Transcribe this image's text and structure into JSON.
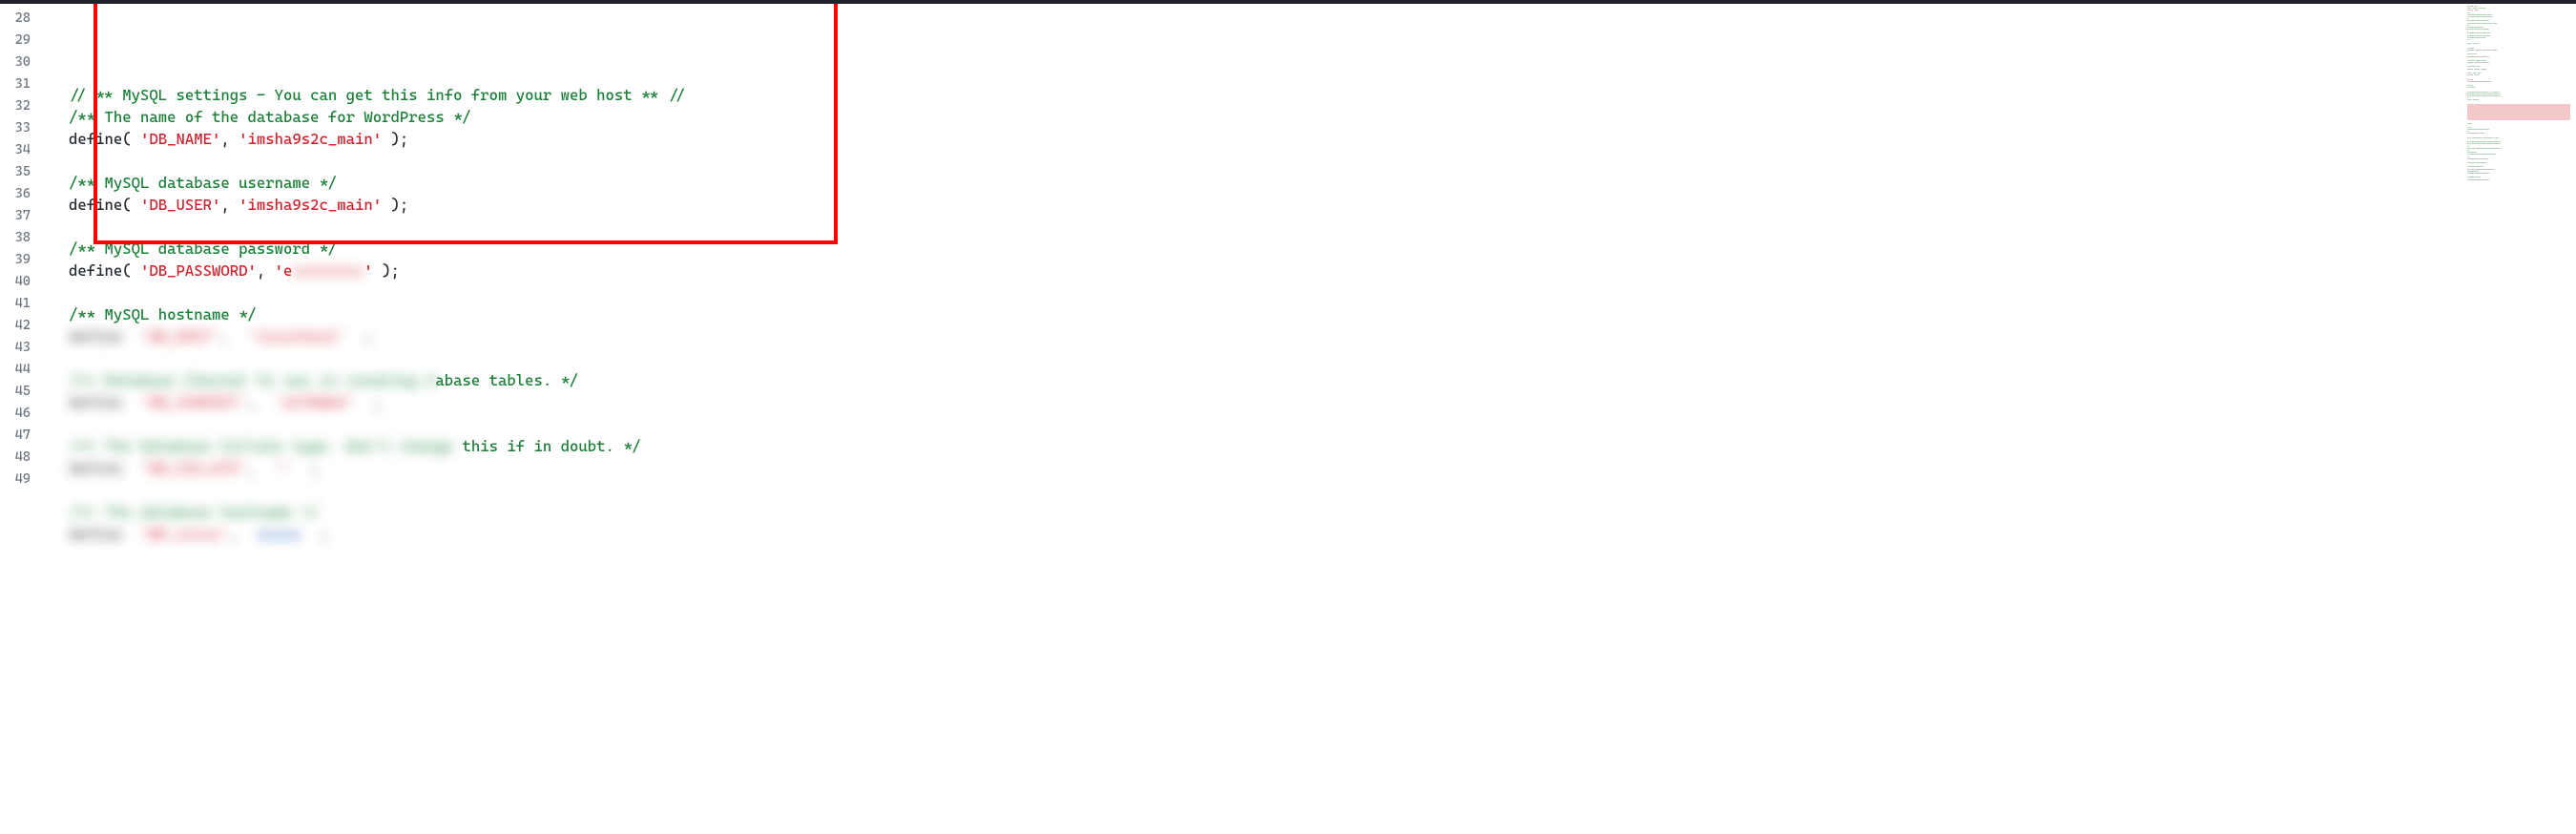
{
  "editor": {
    "startLine": 28,
    "lines": [
      {
        "num": 28,
        "segments": []
      },
      {
        "num": 29,
        "segments": [
          {
            "cls": "tok-comment",
            "text": "// ** MySQL settings - You can get this info from your web host ** //"
          }
        ]
      },
      {
        "num": 30,
        "segments": [
          {
            "cls": "tok-comment",
            "text": "/** The name of the database for WordPress */"
          }
        ]
      },
      {
        "num": 31,
        "segments": [
          {
            "cls": "tok-func",
            "text": "define"
          },
          {
            "cls": "tok-punct",
            "text": "( "
          },
          {
            "cls": "tok-string",
            "text": "'DB_NAME'"
          },
          {
            "cls": "tok-punct",
            "text": ", "
          },
          {
            "cls": "tok-string",
            "text": "'imsha9s2c_main'"
          },
          {
            "cls": "tok-punct",
            "text": " );"
          }
        ]
      },
      {
        "num": 32,
        "segments": []
      },
      {
        "num": 33,
        "segments": [
          {
            "cls": "tok-comment",
            "text": "/** MySQL database username */"
          }
        ]
      },
      {
        "num": 34,
        "segments": [
          {
            "cls": "tok-func",
            "text": "define"
          },
          {
            "cls": "tok-punct",
            "text": "( "
          },
          {
            "cls": "tok-string",
            "text": "'DB_USER'"
          },
          {
            "cls": "tok-punct",
            "text": ", "
          },
          {
            "cls": "tok-string",
            "text": "'imsha9s2c_main'"
          },
          {
            "cls": "tok-punct",
            "text": " );"
          }
        ]
      },
      {
        "num": 35,
        "segments": []
      },
      {
        "num": 36,
        "segments": [
          {
            "cls": "tok-comment",
            "text": "/** MySQL database password */"
          }
        ]
      },
      {
        "num": 37,
        "segments": [
          {
            "cls": "tok-func",
            "text": "define"
          },
          {
            "cls": "tok-punct",
            "text": "( "
          },
          {
            "cls": "tok-string",
            "text": "'DB_PASSWORD'"
          },
          {
            "cls": "tok-punct",
            "text": ", "
          },
          {
            "cls": "tok-string",
            "text": "'e"
          },
          {
            "cls": "tok-string blur-overlay",
            "text": "xxxxxxxx"
          },
          {
            "cls": "tok-string",
            "text": "'"
          },
          {
            "cls": "tok-punct",
            "text": " );"
          }
        ]
      },
      {
        "num": 38,
        "segments": []
      },
      {
        "num": 39,
        "segments": [
          {
            "cls": "tok-comment",
            "text": "/** MySQL hostname */"
          }
        ]
      },
      {
        "num": 40,
        "segments": [
          {
            "cls": "blur-overlay blur-dark",
            "text": "define  "
          },
          {
            "cls": "blur-overlay blur-red",
            "text": "'DB_HOST'"
          },
          {
            "cls": "blur-overlay blur-dark",
            "text": ",  "
          },
          {
            "cls": "blur-overlay blur-red",
            "text": "'localhost'"
          },
          {
            "cls": "blur-overlay blur-dark",
            "text": "  ;"
          }
        ]
      },
      {
        "num": 41,
        "segments": []
      },
      {
        "num": 42,
        "segments": [
          {
            "cls": "blur-overlay blur-green",
            "text": "/** Database Charset to use in creating d"
          },
          {
            "cls": "tok-comment",
            "text": "abase tables. */"
          }
        ]
      },
      {
        "num": 43,
        "segments": [
          {
            "cls": "blur-overlay blur-dark",
            "text": "define  "
          },
          {
            "cls": "blur-overlay blur-red",
            "text": "'DB_CHARSET'"
          },
          {
            "cls": "blur-overlay blur-dark",
            "text": ",  "
          },
          {
            "cls": "blur-overlay blur-red",
            "text": "'utf8mb4'"
          },
          {
            "cls": "blur-overlay blur-dark",
            "text": "  ;"
          }
        ]
      },
      {
        "num": 44,
        "segments": []
      },
      {
        "num": 45,
        "segments": [
          {
            "cls": "blur-overlay blur-green",
            "text": "/** The Database Collate type. Don't change"
          },
          {
            "cls": "tok-comment",
            "text": " this if in doubt. */"
          }
        ]
      },
      {
        "num": 46,
        "segments": [
          {
            "cls": "blur-overlay blur-dark",
            "text": "define  "
          },
          {
            "cls": "blur-overlay blur-red",
            "text": "'DB_COLLATE'"
          },
          {
            "cls": "blur-overlay blur-dark",
            "text": ",  "
          },
          {
            "cls": "blur-overlay blur-red",
            "text": "''"
          },
          {
            "cls": "blur-overlay blur-dark",
            "text": "  ;"
          }
        ]
      },
      {
        "num": 47,
        "segments": []
      },
      {
        "num": 48,
        "segments": [
          {
            "cls": "blur-overlay blur-green",
            "text": "/** The database hostname */"
          }
        ]
      },
      {
        "num": 49,
        "segments": [
          {
            "cls": "blur-overlay blur-dark",
            "text": "define  "
          },
          {
            "cls": "blur-overlay blur-red",
            "text": "'WP_xxxxx'"
          },
          {
            "cls": "blur-overlay blur-dark",
            "text": ",  "
          },
          {
            "cls": "blur-overlay blur-blue",
            "text": "xxxxx"
          },
          {
            "cls": "blur-overlay blur-dark",
            "text": "  ;"
          }
        ]
      }
    ]
  },
  "minimap": {
    "lines": [
      {
        "c": "mm-dark",
        "t": "xxxxx xxx"
      },
      {
        "c": "mm-green",
        "t": "xxxx xxxx xxxxxx"
      },
      {
        "c": "mm-red",
        "t": "xxxxx xxxx"
      },
      {
        "c": "mm-green",
        "t": "xx"
      },
      {
        "c": "mm-green",
        "t": "xxxxxxxxxxxxxxxxxxxxxx"
      },
      {
        "c": "mm-green",
        "t": "xxxxxxxxxxxxxxxxxxxxxx"
      },
      {
        "c": "mm-green",
        "t": "x"
      },
      {
        "c": "mm-green",
        "t": "xxxxxxxxxxxxxxxxxxx"
      },
      {
        "c": "mm-green",
        "t": "xxxxxxxxxxxxxxxxxxxxxxxxxx"
      },
      {
        "c": "mm-green",
        "t": "xx"
      },
      {
        "c": "mm-green",
        "t": "xxxxxxxxxxxxxx"
      },
      {
        "c": "mm-green",
        "t": "xxxxx xxxxxxxxxxxxx"
      },
      {
        "c": "mm-green",
        "t": "x"
      },
      {
        "c": "mm-green",
        "t": "xxxxxxxxxxxxxxxxxxxx"
      },
      {
        "c": "mm-green",
        "t": "xxxxxxxxxxxxxxxxxxxx"
      },
      {
        "c": "mm-green",
        "t": "xxxxxxxxxxxxxxxx"
      },
      {
        "c": "mm-green",
        "t": "xx"
      },
      {
        "c": "",
        "t": ""
      },
      {
        "c": "mm-green",
        "t": "xxxx xxxxx"
      },
      {
        "c": "",
        "t": ""
      },
      {
        "c": "mm-green",
        "t": "xxxxxx"
      },
      {
        "c": "mm-dark",
        "t": "xxxxxx xxxxxx xxxxxx xxxxx"
      },
      {
        "c": "",
        "t": ""
      },
      {
        "c": "mm-green",
        "t": "xxxxxxxx"
      },
      {
        "c": "mm-dark",
        "t": "xxxxxxxxxxxxxxxxxxx"
      },
      {
        "c": "",
        "t": ""
      },
      {
        "c": "mm-green",
        "t": "xxxxxxxxxxxxxxxxx"
      },
      {
        "c": "mm-dark",
        "t": "xxxxx xxxxxx xxxxxx"
      },
      {
        "c": "",
        "t": ""
      },
      {
        "c": "mm-green",
        "t": "xxxxxxxxxxx"
      },
      {
        "c": "mm-dark",
        "t": "xxxxx xxxxx xxxxx"
      },
      {
        "c": "",
        "t": ""
      },
      {
        "c": "mm-green",
        "t": "xxxx xxx xxx"
      },
      {
        "c": "mm-dark",
        "t": "xxxxx xxxx"
      },
      {
        "c": "",
        "t": ""
      },
      {
        "c": "mm-red",
        "t": "xxxxx"
      },
      {
        "c": "mm-dark",
        "t": "xxxxxxxxxxxxxxxxxxxxx"
      },
      {
        "c": "",
        "t": ""
      },
      {
        "c": "mm-green",
        "t": "xxxxx"
      },
      {
        "c": "mm-green",
        "t": "xxxxxxx"
      },
      {
        "c": "",
        "t": ""
      },
      {
        "c": "mm-green",
        "t": "xxxxxxxxxxxxxxxxxxx xxxxxxxx"
      },
      {
        "c": "mm-green",
        "t": "xxxxxxxxxxxxxxxxxxxxxxxxxxxxx"
      },
      {
        "c": "mm-green",
        "t": "xxxxxxxxxxxxxxxxxxxxxxxxxxxxx"
      },
      {
        "c": "mm-green",
        "t": "xx"
      },
      {
        "c": "mm-green",
        "t": "xxxx xxxxx"
      },
      {
        "c": "",
        "t": ""
      },
      {
        "c": "mm-redblock",
        "t": "                                        "
      },
      {
        "c": "mm-redblock",
        "t": "                                        "
      },
      {
        "c": "mm-redblock",
        "t": "                                        "
      },
      {
        "c": "mm-redblock",
        "t": "                                        "
      },
      {
        "c": "mm-redblock",
        "t": "                                        "
      },
      {
        "c": "mm-redblock",
        "t": "                                        "
      },
      {
        "c": "mm-redblock",
        "t": "                                        "
      },
      {
        "c": "mm-redblock",
        "t": "                                        "
      },
      {
        "c": "",
        "t": ""
      },
      {
        "c": "mm-green",
        "t": "xxxx"
      },
      {
        "c": "",
        "t": ""
      },
      {
        "c": "mm-green",
        "t": "xxxx"
      },
      {
        "c": "mm-green",
        "t": "xxxxxxxxxxxxxxxxxxx"
      },
      {
        "c": "mm-green",
        "t": "xx"
      },
      {
        "c": "mm-dark",
        "t": "xxxxxxxxxx xxxx"
      },
      {
        "c": "",
        "t": ""
      },
      {
        "c": "mm-green",
        "t": "xxx xxxxxxxxx xxxxxxxxx xxxx"
      },
      {
        "c": "",
        "t": ""
      },
      {
        "c": "mm-green",
        "t": "xxxxxxxxxxxxxxxxxxxxxxxxxxxxx"
      },
      {
        "c": "mm-green",
        "t": "xxxxxxxxxxxxxxxxxxxxxxxxxxxxx"
      },
      {
        "c": "mm-green",
        "t": "xx"
      },
      {
        "c": "mm-green",
        "t": "xxxxxxxxxxxxxxxxxxxxxxxxxxxxx"
      },
      {
        "c": "mm-green",
        "t": "xx"
      },
      {
        "c": "mm-green",
        "t": "xxxxxxxx"
      },
      {
        "c": "mm-green",
        "t": "xxxxxxxxxxxxxxxxxxxxxxxxx"
      },
      {
        "c": "mm-green",
        "t": "xx"
      },
      {
        "c": "mm-dark",
        "t": "xxxxxxxxxx xxxxxxx"
      },
      {
        "c": "",
        "t": ""
      },
      {
        "c": "mm-green",
        "t": "xxxxxxxxxxxxxxxxx"
      },
      {
        "c": "",
        "t": ""
      },
      {
        "c": "mm-green",
        "t": "xxxxxxxxxxxxxx"
      },
      {
        "c": "mm-dark",
        "t": "xxx xxxxxxxxxxxxxxxxxxx"
      },
      {
        "c": "mm-green",
        "t": "xxxxxxxxxx"
      },
      {
        "c": "mm-dark",
        "t": "xxxxxxxxxxxxxxxxxxx"
      },
      {
        "c": "",
        "t": ""
      },
      {
        "c": "mm-green",
        "t": "xxxxxxxxxxxx"
      },
      {
        "c": "mm-dark",
        "t": "xxxxxxxxxxxxxxxxxxx"
      }
    ]
  }
}
